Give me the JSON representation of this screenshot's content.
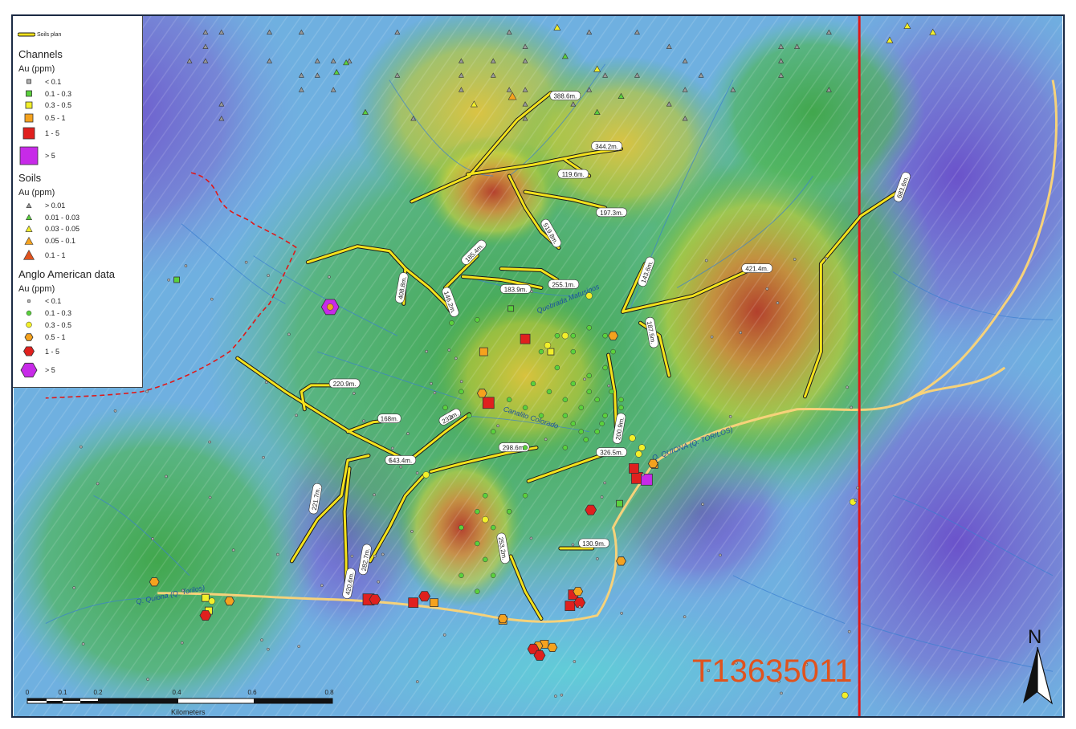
{
  "legend": {
    "soils_plan_label": "Soils plan",
    "channels": {
      "title": "Channels",
      "unit": "Au (ppm)",
      "classes": [
        "< 0.1",
        "0.1 - 0.3",
        "0.3 - 0.5",
        "0.5 - 1",
        "1 - 5",
        "> 5"
      ]
    },
    "soils": {
      "title": "Soils",
      "unit": "Au (ppm)",
      "classes": [
        "> 0.01",
        "0.01 - 0.03",
        "0.03 - 0.05",
        "0.05 - 0.1",
        "0.1 - 1"
      ]
    },
    "anglo": {
      "title": "Anglo American data",
      "unit": "Au (ppm)",
      "classes": [
        "< 0.1",
        "0.1 - 0.3",
        "0.3 - 0.5",
        "0.5 - 1",
        "1 - 5",
        "> 5"
      ]
    }
  },
  "colors": {
    "grey": "#b4b4b4",
    "green": "#5ad13c",
    "yellow": "#f2ef2a",
    "orange": "#f5a21e",
    "red": "#e0201e",
    "purple": "#c72ae8",
    "soils_plan": "#f4e21c",
    "boundary_red": "#e01818",
    "road": "#f6d27a"
  },
  "soil_line_labels": [
    "388.6m.",
    "344.2m.",
    "119.6m.",
    "197.3m.",
    "519.8m.",
    "185.4m.",
    "408.8m.",
    "146.2m.",
    "183.9m.",
    "255.1m.",
    "143.6m.",
    "421.4m.",
    "187.5m.",
    "683.6m.",
    "220.9m.",
    "168m.",
    "232m.",
    "200.9m.",
    "543.4m.",
    "298.6m.",
    "326.5m.",
    "221.7m.",
    "282.7m.",
    "420.6m.",
    "253.2m.",
    "130.9m."
  ],
  "place_labels": {
    "q_matusinos": "Quebrada Matusinos",
    "q_quiona": "Q. QUIONA (Q. TORILOS)",
    "q_quiona2": "Q. Quiona (Q. Torilos)",
    "canalito": "Canalito Colorado"
  },
  "scale": {
    "ticks": [
      "0",
      "0.1",
      "0.2",
      "0.4",
      "0.6",
      "0.8"
    ],
    "unit": "Kilometers"
  },
  "north": "N",
  "tenement_code": "T13635011"
}
